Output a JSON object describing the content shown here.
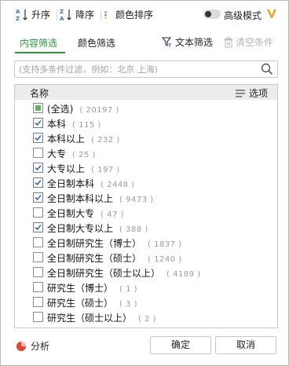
{
  "toolbar": {
    "sort_asc_label": "升序",
    "sort_desc_label": "降序",
    "color_sort_label": "颜色排序",
    "advanced_mode_label": "高级模式",
    "advanced_mode_on": false
  },
  "tabs": [
    {
      "label": "内容筛选",
      "active": true
    },
    {
      "label": "颜色筛选",
      "active": false
    }
  ],
  "text_filter_label": "文本筛选",
  "clear_label": "清空条件",
  "search": {
    "placeholder": "(支持多条件过滤，例如：北京 上海)",
    "value": ""
  },
  "list": {
    "header_name": "名称",
    "options_label": "选项",
    "items": [
      {
        "label": "(全选)",
        "count": "( 20197 )",
        "state": "partial"
      },
      {
        "label": "本科",
        "count": "( 115 )",
        "state": "checked"
      },
      {
        "label": "本科以上",
        "count": "( 232 )",
        "state": "checked"
      },
      {
        "label": "大专",
        "count": "( 25 )",
        "state": "unchecked"
      },
      {
        "label": "大专以上",
        "count": "( 197 )",
        "state": "checked"
      },
      {
        "label": "全日制本科",
        "count": "( 2448 )",
        "state": "checked"
      },
      {
        "label": "全日制本科以上",
        "count": "( 9473 )",
        "state": "checked"
      },
      {
        "label": "全日制大专",
        "count": "( 47 )",
        "state": "unchecked"
      },
      {
        "label": "全日制大专以上",
        "count": "( 388 )",
        "state": "checked"
      },
      {
        "label": "全日制研究生（博士）",
        "count": "( 1837 )",
        "state": "unchecked"
      },
      {
        "label": "全日制研究生（硕士）",
        "count": "( 1240 )",
        "state": "unchecked"
      },
      {
        "label": "全日制研究生（硕士以上）",
        "count": "( 4189 )",
        "state": "unchecked"
      },
      {
        "label": "研究生（博士）",
        "count": "( 1 )",
        "state": "unchecked"
      },
      {
        "label": "研究生（硕士）",
        "count": "( 3 )",
        "state": "unchecked"
      },
      {
        "label": "研究生（硕士以上）",
        "count": "( 2 )",
        "state": "unchecked"
      }
    ]
  },
  "footer": {
    "analyze_label": "分析",
    "ok_label": "确定",
    "cancel_label": "取消"
  },
  "colors": {
    "accent_green": "#2a9a3c",
    "checkbox_check": "#2f6fc9",
    "partial_fill": "#62b35f",
    "v_logo": "#f2a31b",
    "analyze_pie_red": "#e2462f"
  },
  "icons": {
    "sort_asc": "sort-ascending-icon",
    "sort_desc": "sort-descending-icon",
    "color_sort": "color-sort-icon",
    "advanced": "v-logo-icon",
    "text_filter": "funnel-text-icon",
    "clear": "trash-icon",
    "search": "search-icon",
    "options": "list-options-icon",
    "analyze": "pie-chart-icon"
  }
}
